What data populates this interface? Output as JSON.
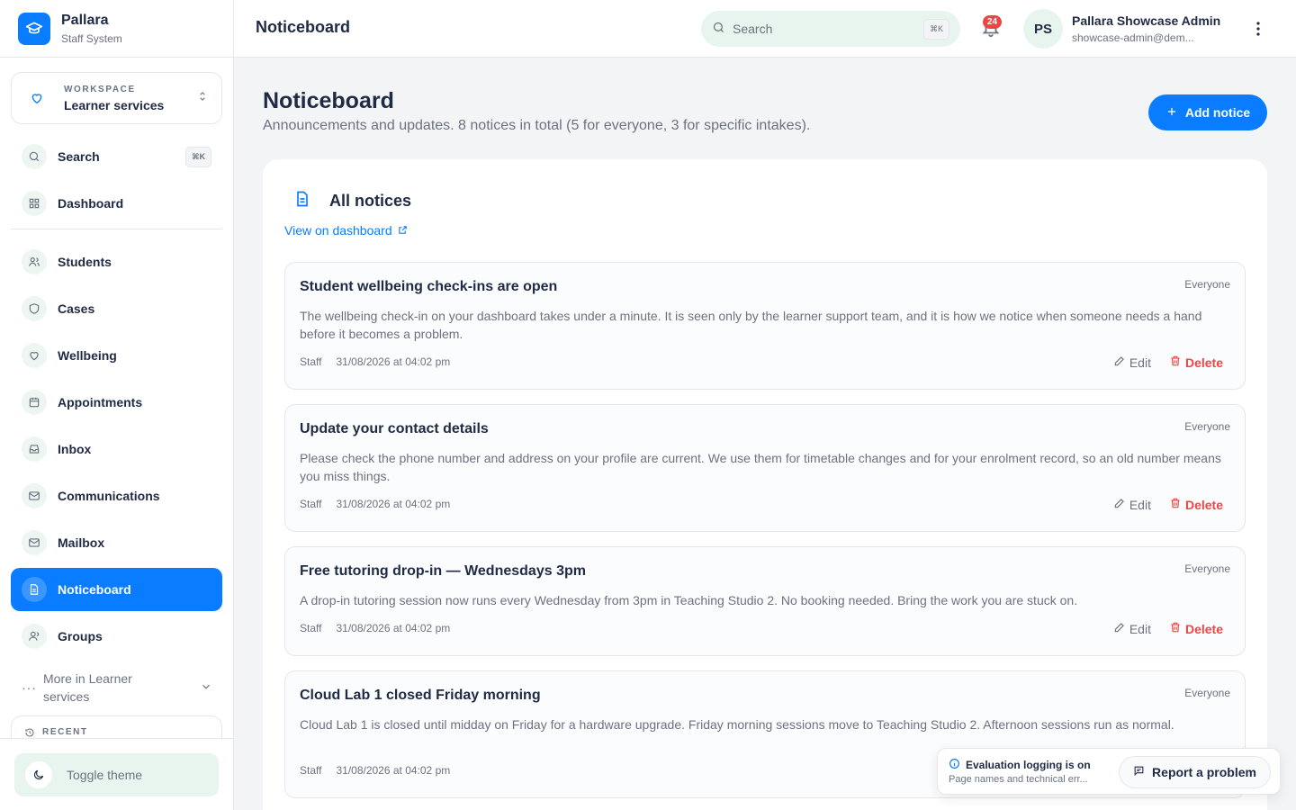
{
  "brand": {
    "name": "Pallara",
    "subtitle": "Staff System"
  },
  "workspace": {
    "kicker": "WORKSPACE",
    "name": "Learner services"
  },
  "sidebar": {
    "search": {
      "label": "Search",
      "shortcut": "⌘K"
    },
    "items": [
      {
        "label": "Dashboard",
        "icon": "grid-icon"
      },
      {
        "label": "Students",
        "icon": "users-icon"
      },
      {
        "label": "Cases",
        "icon": "shield-icon"
      },
      {
        "label": "Wellbeing",
        "icon": "heart-icon"
      },
      {
        "label": "Appointments",
        "icon": "calendar-icon"
      },
      {
        "label": "Inbox",
        "icon": "inbox-icon"
      },
      {
        "label": "Communications",
        "icon": "mail-icon"
      },
      {
        "label": "Mailbox",
        "icon": "mail-icon"
      },
      {
        "label": "Noticeboard",
        "icon": "document-icon",
        "active": true
      },
      {
        "label": "Groups",
        "icon": "user-icon"
      }
    ],
    "more": "More in Learner services",
    "recent": "RECENT",
    "toggle_theme": "Toggle theme"
  },
  "topbar": {
    "title": "Noticeboard",
    "search_placeholder": "Search",
    "search_shortcut": "⌘K",
    "notifications_count": "24",
    "avatar_initials": "PS",
    "user_name": "Pallara Showcase Admin",
    "user_email": "showcase-admin@dem..."
  },
  "page": {
    "title": "Noticeboard",
    "description": "Announcements and updates. 8 notices in total (5 for everyone, 3 for specific intakes).",
    "add_button": "Add notice"
  },
  "notices_card": {
    "title": "All notices",
    "view_link": "View on dashboard",
    "edit_label": "Edit",
    "delete_label": "Delete",
    "notices": [
      {
        "title": "Student wellbeing check-ins are open",
        "audience": "Everyone",
        "body": "The wellbeing check-in on your dashboard takes under a minute. It is seen only by the learner support team, and it is how we notice when someone needs a hand before it becomes a problem.",
        "author": "Staff",
        "date": "31/08/2026 at 04:02 pm"
      },
      {
        "title": "Update your contact details",
        "audience": "Everyone",
        "body": "Please check the phone number and address on your profile are current. We use them for timetable changes and for your enrolment record, so an old number means you miss things.",
        "author": "Staff",
        "date": "31/08/2026 at 04:02 pm"
      },
      {
        "title": "Free tutoring drop-in — Wednesdays 3pm",
        "audience": "Everyone",
        "body": "A drop-in tutoring session now runs every Wednesday from 3pm in Teaching Studio 2. No booking needed. Bring the work you are stuck on.",
        "author": "Staff",
        "date": "31/08/2026 at 04:02 pm"
      },
      {
        "title": "Cloud Lab 1 closed Friday morning",
        "audience": "Everyone",
        "body": "Cloud Lab 1 is closed until midday on Friday for a hardware upgrade. Friday morning sessions move to Teaching Studio 2. Afternoon sessions run as normal.",
        "author": "Staff",
        "date": "31/08/2026 at 04:02 pm"
      }
    ]
  },
  "toast": {
    "title": "Evaluation logging is on",
    "subtitle": "Page names and technical err...",
    "report_button": "Report a problem"
  },
  "colors": {
    "accent": "#0a7cff",
    "danger": "#ef4444",
    "mint": "#e8f5ef"
  }
}
